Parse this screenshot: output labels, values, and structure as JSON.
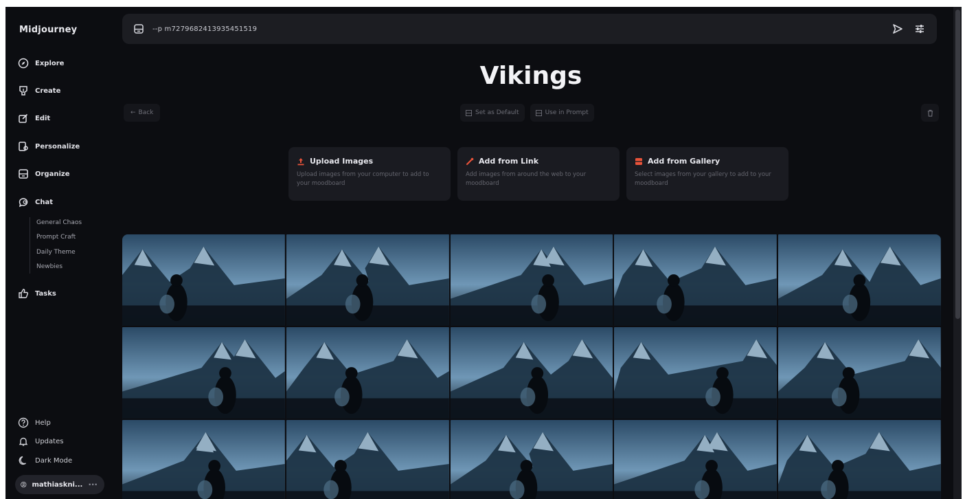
{
  "app": {
    "brand": "Midjourney"
  },
  "sidebar": {
    "items": [
      {
        "label": "Explore",
        "icon": "compass-icon"
      },
      {
        "label": "Create",
        "icon": "brush-icon"
      },
      {
        "label": "Edit",
        "icon": "edit-icon"
      },
      {
        "label": "Personalize",
        "icon": "personalize-icon"
      },
      {
        "label": "Organize",
        "icon": "folder-icon"
      },
      {
        "label": "Chat",
        "icon": "chat-icon"
      }
    ],
    "chat_channels": [
      "General Chaos",
      "Prompt Craft",
      "Daily Theme",
      "Newbies"
    ],
    "tasks": {
      "label": "Tasks",
      "icon": "thumbs-up-icon"
    },
    "bottom": [
      {
        "label": "Help",
        "icon": "help-icon"
      },
      {
        "label": "Updates",
        "icon": "bell-icon"
      },
      {
        "label": "Dark Mode",
        "icon": "moon-icon"
      }
    ],
    "user": {
      "name": "mathiaskni...",
      "menu": "···"
    }
  },
  "prompt_bar": {
    "value": "--p m7279682413935451519"
  },
  "page": {
    "title": "Vikings",
    "back_label": "Back",
    "set_default_label": "Set as Default",
    "use_in_prompt_label": "Use in Prompt"
  },
  "cards": [
    {
      "title": "Upload Images",
      "desc": "Upload images from your computer to add to your moodboard",
      "icon": "upload-icon",
      "color": "#e8533a"
    },
    {
      "title": "Add from Link",
      "desc": "Add images from around the web to your moodboard",
      "icon": "link-icon",
      "color": "#e8533a"
    },
    {
      "title": "Add from Gallery",
      "desc": "Select images from your gallery to add to your moodboard",
      "icon": "gallery-icon",
      "color": "#e8533a"
    }
  ],
  "gallery": {
    "tiles": 15,
    "palette": {
      "sky": "#2b4a66",
      "snow": "#a9c4d8",
      "dark": "#0b1118",
      "accent": "#6f97b6"
    }
  }
}
